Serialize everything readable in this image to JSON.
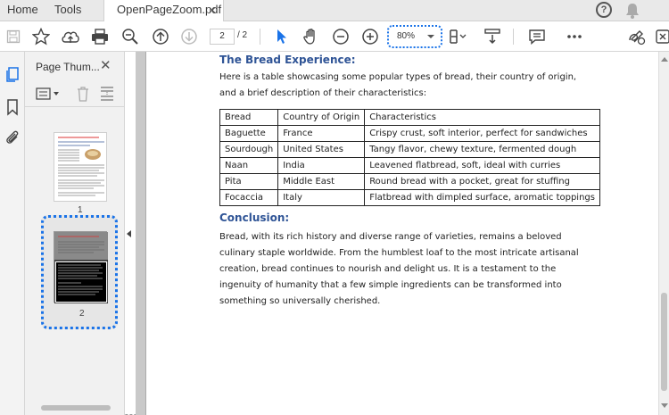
{
  "tabs": {
    "home": "Home",
    "tools": "Tools",
    "document": "OpenPageZoom.pdf",
    "close": "×"
  },
  "toolbar": {
    "current_page": "2",
    "total_pages": "/ 2",
    "zoom": "80%"
  },
  "panel": {
    "title": "Page Thum...",
    "close": "✕",
    "thumb1_label": "1",
    "thumb2_label": "2"
  },
  "document": {
    "heading1": "The Bread Experience:",
    "intro": "Here is a table showcasing some popular types of bread, their country of origin, and a brief description of their characteristics:",
    "table_headers": [
      "Bread",
      "Country of Origin",
      "Characteristics"
    ],
    "table_rows": [
      [
        "Baguette",
        "France",
        "Crispy crust, soft interior, perfect for sandwiches"
      ],
      [
        "Sourdough",
        "United States",
        "Tangy flavor, chewy texture, fermented dough"
      ],
      [
        "Naan",
        "India",
        "Leavened flatbread, soft, ideal with curries"
      ],
      [
        "Pita",
        "Middle East",
        "Round bread with a pocket, great for stuffing"
      ],
      [
        "Focaccia",
        "Italy",
        "Flatbread with dimpled surface, aromatic toppings"
      ]
    ],
    "heading2": "Conclusion:",
    "conclusion": "Bread, with its rich history and diverse range of varieties, remains a beloved culinary staple worldwide. From the humblest loaf to the most intricate artisanal creation, bread continues to nourish and delight us. It is a testament to the ingenuity of humanity that a few simple ingredients can be transformed into something so universally cherished."
  },
  "colors": {
    "accent": "#1a73e8",
    "heading": "#2f5496"
  }
}
